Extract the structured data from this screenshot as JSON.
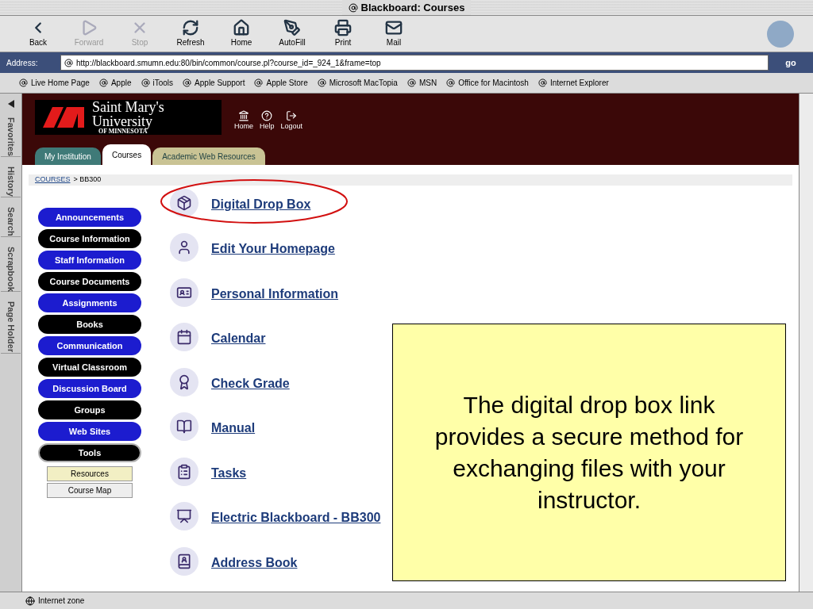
{
  "window": {
    "title": "Blackboard: Courses"
  },
  "toolbar": [
    {
      "label": "Back",
      "disabled": false
    },
    {
      "label": "Forward",
      "disabled": true
    },
    {
      "label": "Stop",
      "disabled": true
    },
    {
      "label": "Refresh",
      "disabled": false
    },
    {
      "label": "Home",
      "disabled": false
    },
    {
      "label": "AutoFill",
      "disabled": false
    },
    {
      "label": "Print",
      "disabled": false
    },
    {
      "label": "Mail",
      "disabled": false
    }
  ],
  "address": {
    "label": "Address:",
    "value": "http://blackboard.smumn.edu:80/bin/common/course.pl?course_id=_924_1&frame=top",
    "go": "go"
  },
  "favorites": [
    "Live Home Page",
    "Apple",
    "iTools",
    "Apple Support",
    "Apple Store",
    "Microsoft MacTopia",
    "MSN",
    "Office for Macintosh",
    "Internet Explorer"
  ],
  "side_tabs": [
    "Favorites",
    "History",
    "Search",
    "Scrapbook",
    "Page Holder"
  ],
  "header": {
    "logo": [
      "Saint Mary's",
      "University",
      "OF MINNESOTA"
    ],
    "links": [
      "Home",
      "Help",
      "Logout"
    ]
  },
  "tabs": [
    {
      "label": "My Institution",
      "selected": false,
      "color": "#3f7a78"
    },
    {
      "label": "Courses",
      "selected": true,
      "color": "#ffffff"
    },
    {
      "label": "Academic Web Resources",
      "selected": false,
      "color": "#c9c394"
    }
  ],
  "breadcrumb": {
    "link": "COURSES",
    "rest": "> BB300"
  },
  "course_menu": [
    {
      "label": "Announcements",
      "color": "#1c1ccf",
      "selected": false
    },
    {
      "label": "Course Information",
      "color": "#000000",
      "selected": false
    },
    {
      "label": "Staff Information",
      "color": "#1c1ccf",
      "selected": false
    },
    {
      "label": "Course Documents",
      "color": "#000000",
      "selected": false
    },
    {
      "label": "Assignments",
      "color": "#1c1ccf",
      "selected": false
    },
    {
      "label": "Books",
      "color": "#000000",
      "selected": false
    },
    {
      "label": "Communication",
      "color": "#1c1ccf",
      "selected": false
    },
    {
      "label": "Virtual Classroom",
      "color": "#000000",
      "selected": false
    },
    {
      "label": "Discussion Board",
      "color": "#1c1ccf",
      "selected": false
    },
    {
      "label": "Groups",
      "color": "#000000",
      "selected": false
    },
    {
      "label": "Web Sites",
      "color": "#1c1ccf",
      "selected": false
    },
    {
      "label": "Tools",
      "color": "#000000",
      "selected": true
    }
  ],
  "sub_menu": [
    {
      "label": "Resources",
      "selected": true
    },
    {
      "label": "Course Map",
      "selected": false
    }
  ],
  "tools": [
    {
      "label": "Digital Drop Box"
    },
    {
      "label": "Edit Your Homepage"
    },
    {
      "label": "Personal Information"
    },
    {
      "label": "Calendar"
    },
    {
      "label": "Check Grade"
    },
    {
      "label": "Manual"
    },
    {
      "label": "Tasks"
    },
    {
      "label": "Electric Blackboard - BB300"
    },
    {
      "label": "Address Book"
    }
  ],
  "annotation": {
    "kind": "ellipse"
  },
  "note": "The digital drop box link provides a secure method for exchanging files with your instructor.",
  "status": "Internet zone"
}
